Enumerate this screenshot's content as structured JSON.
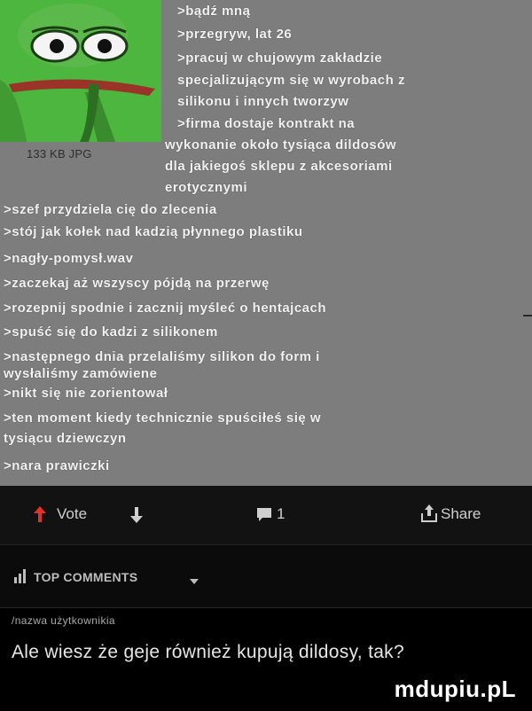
{
  "post": {
    "thumbnail_caption": "133 KB JPG",
    "lines": [
      ">bądź mną",
      ">przegryw, lat 26",
      ">pracuj w chujowym zakładzie",
      "specjalizującym się w wyrobach z",
      "silikonu i innych tworzyw",
      ">firma dostaje kontrakt na",
      "wykonanie około tysiąca dildosów",
      "dla jakiegoś sklepu z akcesoriami",
      "erotycznymi",
      ">szef przydziela cię do zlecenia",
      ">stój jak kołek nad kadzią płynnego plastiku",
      ">nagły-pomysł.wav",
      ">zaczekaj aż wszyscy pójdą na przerwę",
      ">rozepnij spodnie i zacznij myśleć o hentajcach",
      ">spuść się do kadzi z silikonem",
      ">następnego dnia przelaliśmy silikon do form i",
      "wysłaliśmy zamówiene",
      ">nikt się nie zorientował",
      ">ten moment kiedy technicznie spuściłeś się w",
      "tysiącu  dziewczyn",
      ">nara prawiczki"
    ]
  },
  "actions": {
    "vote_label": "Vote",
    "comments_count": "1",
    "share_label": "Share",
    "accent_color": "#e0322b"
  },
  "top_comments": {
    "label": "TOP COMMENTS"
  },
  "comment": {
    "username": "/nazwa użytkownikia",
    "text": "Ale wiesz że geje również kupują dildosy, tak?"
  },
  "watermark": "mdupiu.pL"
}
